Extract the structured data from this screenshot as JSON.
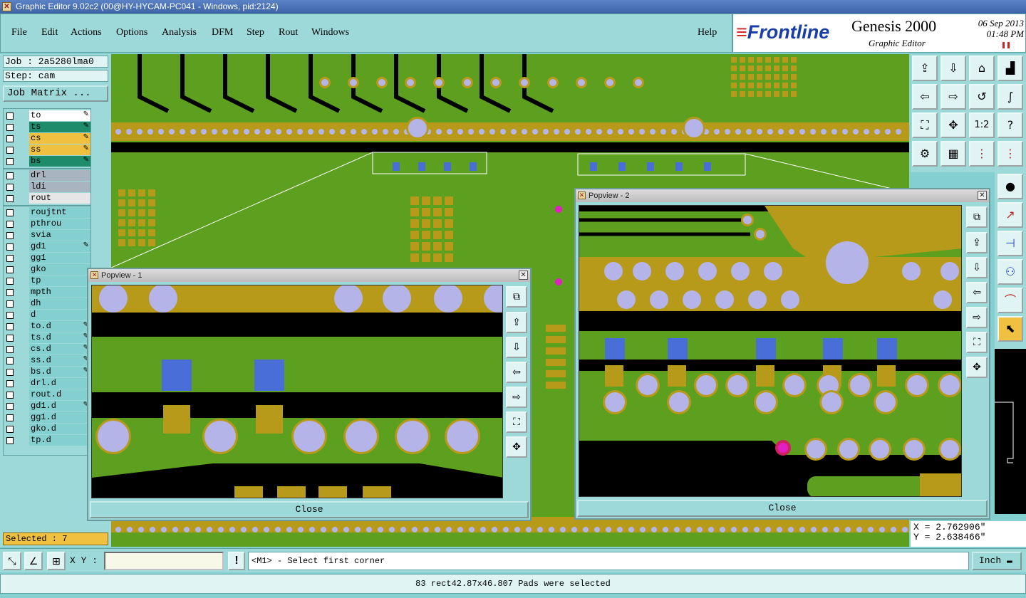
{
  "window": {
    "title": "Graphic Editor 9.02c2 (00@HY-HYCAM-PC041 - Windows, pid:2124)"
  },
  "menu": [
    "File",
    "Edit",
    "Actions",
    "Options",
    "Analysis",
    "DFM",
    "Step",
    "Rout",
    "Windows"
  ],
  "help_label": "Help",
  "brand": {
    "logo_text": "Frontline",
    "product": "Genesis 2000",
    "subtitle": "Graphic Editor",
    "date": "06 Sep 2013",
    "time": "01:48 PM"
  },
  "job": {
    "job_label": "Job : 2a5280lma0",
    "step_label": "Step: cam",
    "matrix_button": "Job Matrix ..."
  },
  "layers": [
    {
      "name": "to",
      "color": "#ffffff",
      "pen": true
    },
    {
      "name": "ts",
      "color": "#1e8c6a",
      "pen": true
    },
    {
      "name": "cs",
      "color": "#f0c040",
      "pen": true
    },
    {
      "name": "ss",
      "color": "#f0c040",
      "pen": true
    },
    {
      "name": "bs",
      "color": "#1e8c6a",
      "pen": true
    },
    {
      "name": "drl",
      "color": "#a8b4c0",
      "pen": false
    },
    {
      "name": "ldi",
      "color": "#a8b4c0",
      "pen": false
    },
    {
      "name": "rout",
      "color": "#e6e6e6",
      "pen": false
    },
    {
      "name": "roujtnt",
      "color": "#84cfcf",
      "pen": false
    },
    {
      "name": "pthrou",
      "color": "#84cfcf",
      "pen": false
    },
    {
      "name": "svia",
      "color": "#84cfcf",
      "pen": false
    },
    {
      "name": "gd1",
      "color": "#84cfcf",
      "pen": true
    },
    {
      "name": "gg1",
      "color": "#84cfcf",
      "pen": false
    },
    {
      "name": "gko",
      "color": "#84cfcf",
      "pen": false
    },
    {
      "name": "tp",
      "color": "#84cfcf",
      "pen": false
    },
    {
      "name": "mpth",
      "color": "#84cfcf",
      "pen": false
    },
    {
      "name": "dh",
      "color": "#84cfcf",
      "pen": false
    },
    {
      "name": "d",
      "color": "#84cfcf",
      "pen": false
    },
    {
      "name": "to.d",
      "color": "#84cfcf",
      "pen": true
    },
    {
      "name": "ts.d",
      "color": "#84cfcf",
      "pen": true
    },
    {
      "name": "cs.d",
      "color": "#84cfcf",
      "pen": true
    },
    {
      "name": "ss.d",
      "color": "#84cfcf",
      "pen": true
    },
    {
      "name": "bs.d",
      "color": "#84cfcf",
      "pen": true
    },
    {
      "name": "drl.d",
      "color": "#84cfcf",
      "pen": false
    },
    {
      "name": "rout.d",
      "color": "#84cfcf",
      "pen": false
    },
    {
      "name": "gd1.d",
      "color": "#84cfcf",
      "pen": true
    },
    {
      "name": "gg1.d",
      "color": "#84cfcf",
      "pen": false
    },
    {
      "name": "gko.d",
      "color": "#84cfcf",
      "pen": false
    },
    {
      "name": "tp.d",
      "color": "#84cfcf",
      "pen": false
    }
  ],
  "selected_label": "Selected : 7",
  "popview1": {
    "title": "Popview - 1",
    "close_label": "Close"
  },
  "popview2": {
    "title": "Popview - 2",
    "close_label": "Close"
  },
  "coords": {
    "x": "X = 2.762906\"",
    "y": "Y = 2.638466\""
  },
  "command": {
    "xy_label": "X Y :",
    "xy_value": "",
    "prompt": "<M1> - Select first corner",
    "unit": "Inch"
  },
  "status": "83 rect42.87x46.807 Pads were selected",
  "colors": {
    "board": "#5d9f1f",
    "copper": "#b89a1a",
    "pad": "#b4b4e8",
    "smd": "#4a6ed8",
    "gap": "#000000",
    "via": "#e020c0"
  }
}
